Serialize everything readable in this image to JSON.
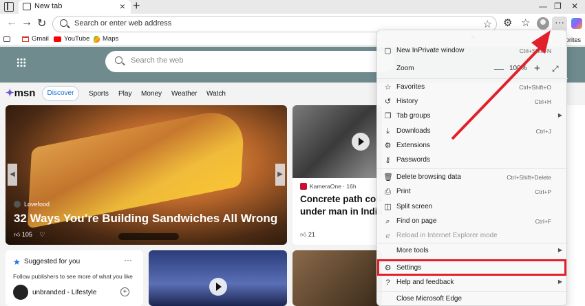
{
  "browser": {
    "tab": {
      "title": "New tab"
    },
    "address_bar": {
      "placeholder": "Search or enter web address"
    },
    "bookmarks": [
      {
        "label": "Gmail"
      },
      {
        "label": "YouTube"
      },
      {
        "label": "Maps"
      }
    ],
    "favorites_label_cut": "orites"
  },
  "page": {
    "search_placeholder": "Search the web",
    "msn_logo": "msn",
    "nav": [
      "Discover",
      "Sports",
      "Play",
      "Money",
      "Weather",
      "Watch"
    ],
    "main_card": {
      "source": "Lovefood",
      "title": "32 Ways You’re Building Sandwiches All Wrong",
      "likes": "105"
    },
    "right_card": {
      "source": "KameraOne · 16h",
      "title_line1": "Concrete path colla",
      "title_line2": "under man in India",
      "likes": "21"
    },
    "suggested": {
      "title": "Suggested for you",
      "subtitle": "Follow publishers to see more of what you like",
      "publisher": "unbranded - Lifestyle"
    }
  },
  "menu": {
    "items": [
      {
        "label": "New InPrivate window",
        "shortcut": "Ctrl+Shift+N",
        "icon": "inprivate-icon"
      },
      {
        "label": "Zoom",
        "value": "100%",
        "icon": ""
      },
      {
        "label": "Favorites",
        "shortcut": "Ctrl+Shift+O",
        "icon": "favorites-icon"
      },
      {
        "label": "History",
        "shortcut": "Ctrl+H",
        "icon": "history-icon"
      },
      {
        "label": "Tab groups",
        "shortcut": "",
        "icon": "tab-groups-icon"
      },
      {
        "label": "Downloads",
        "shortcut": "Ctrl+J",
        "icon": "download-icon"
      },
      {
        "label": "Extensions",
        "shortcut": "",
        "icon": "extensions-icon"
      },
      {
        "label": "Passwords",
        "shortcut": "",
        "icon": "key-icon"
      },
      {
        "label": "Delete browsing data",
        "shortcut": "Ctrl+Shift+Delete",
        "icon": "trash-icon"
      },
      {
        "label": "Print",
        "shortcut": "Ctrl+P",
        "icon": "print-icon"
      },
      {
        "label": "Split screen",
        "shortcut": "",
        "icon": "split-screen-icon"
      },
      {
        "label": "Find on page",
        "shortcut": "Ctrl+F",
        "icon": "find-icon"
      },
      {
        "label": "Reload in Internet Explorer mode",
        "shortcut": "",
        "icon": "ie-mode-icon"
      },
      {
        "label": "More tools",
        "shortcut": "",
        "icon": ""
      },
      {
        "label": "Settings",
        "shortcut": "",
        "icon": "gear-icon"
      },
      {
        "label": "Help and feedback",
        "shortcut": "",
        "icon": "help-icon"
      },
      {
        "label": "Close Microsoft Edge",
        "shortcut": "",
        "icon": ""
      }
    ]
  },
  "colors": {
    "highlight": "#e0202a",
    "arrow": "#e0202a",
    "msn_accent": "#1a6bd6"
  }
}
